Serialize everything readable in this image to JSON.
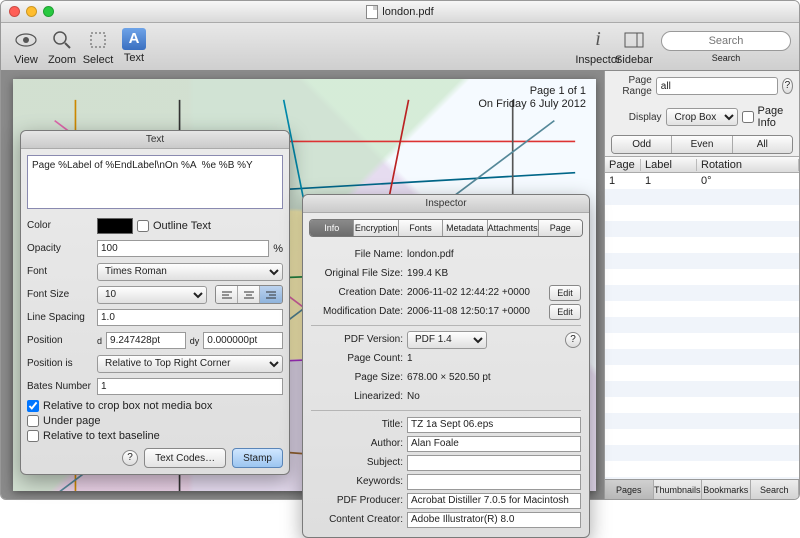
{
  "window": {
    "title": "london.pdf"
  },
  "toolbar": {
    "view": "View",
    "zoom": "Zoom",
    "select": "Select",
    "text": "Text",
    "inspector": "Inspector",
    "sidebar": "Sidebar",
    "search": "Search",
    "search_placeholder": "Search"
  },
  "annotation": {
    "line1": "Page 1 of 1",
    "line2": "On Friday  6 July 2012"
  },
  "text_panel": {
    "title": "Text",
    "content": "Page %Label of %EndLabel\\nOn %A  %e %B %Y",
    "color_label": "Color",
    "outline": "Outline Text",
    "opacity_label": "Opacity",
    "opacity_value": "100",
    "opacity_pct": "%",
    "font_label": "Font",
    "font_value": "Times Roman",
    "fontsize_label": "Font Size",
    "fontsize_value": "10",
    "linespacing_label": "Line Spacing",
    "linespacing_value": "1.0",
    "position_label": "Position",
    "dx": "9.247428pt",
    "dy": "0.000000pt",
    "dx_prefix": "d",
    "dy_prefix": "dy",
    "positionis_label": "Position is",
    "positionis_value": "Relative to Top Right Corner",
    "bates_label": "Bates Number",
    "bates_value": "1",
    "cb_cropbox": "Relative to crop box not media box",
    "cb_underpage": "Under page",
    "cb_baseline": "Relative to text baseline",
    "btn_textcodes": "Text Codes…",
    "btn_stamp": "Stamp"
  },
  "inspector": {
    "title": "Inspector",
    "tabs": [
      "Info",
      "Encryption",
      "Fonts",
      "Metadata",
      "Attachments",
      "Page"
    ],
    "filename_label": "File Name:",
    "filename": "london.pdf",
    "filesize_label": "Original File Size:",
    "filesize": "199.4 KB",
    "created_label": "Creation Date:",
    "created": "2006-11-02 12:44:22 +0000",
    "modified_label": "Modification Date:",
    "modified": "2006-11-08 12:50:17 +0000",
    "edit": "Edit",
    "pdfver_label": "PDF Version:",
    "pdfver": "PDF 1.4",
    "pagecount_label": "Page Count:",
    "pagecount": "1",
    "pagesize_label": "Page Size:",
    "pagesize": "678.00 × 520.50 pt",
    "linearized_label": "Linearized:",
    "linearized": "No",
    "title_label": "Title:",
    "title_val": "TZ 1a Sept 06.eps",
    "author_label": "Author:",
    "author": "Alan Foale",
    "subject_label": "Subject:",
    "subject": "",
    "keywords_label": "Keywords:",
    "keywords": "",
    "producer_label": "PDF Producer:",
    "producer": "Acrobat Distiller 7.0.5 for Macintosh",
    "creator_label": "Content Creator:",
    "creator": "Adobe Illustrator(R) 8.0"
  },
  "sidebar": {
    "pagerange_label": "Page Range",
    "pagerange": "all",
    "display_label": "Display",
    "display": "Crop Box",
    "pageinfo": "Page Info",
    "odd": "Odd",
    "even": "Even",
    "all": "All",
    "col_page": "Page",
    "col_label": "Label",
    "col_rot": "Rotation",
    "rows": [
      {
        "page": "1",
        "label": "1",
        "rot": "0°"
      }
    ],
    "tabs": {
      "pages": "Pages",
      "thumbs": "Thumbnails",
      "bookmarks": "Bookmarks",
      "search": "Search"
    }
  }
}
